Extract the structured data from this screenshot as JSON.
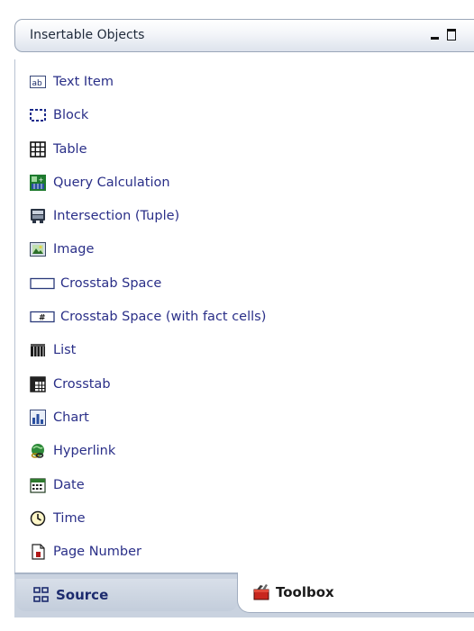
{
  "panel": {
    "title": "Insertable Objects"
  },
  "items": [
    {
      "label": "Text Item",
      "icon": "text-item-icon"
    },
    {
      "label": "Block",
      "icon": "block-icon"
    },
    {
      "label": "Table",
      "icon": "table-icon"
    },
    {
      "label": "Query Calculation",
      "icon": "query-calculation-icon"
    },
    {
      "label": "Intersection (Tuple)",
      "icon": "intersection-icon"
    },
    {
      "label": "Image",
      "icon": "image-icon"
    },
    {
      "label": "Crosstab Space",
      "icon": "crosstab-space-icon"
    },
    {
      "label": "Crosstab Space (with fact cells)",
      "icon": "crosstab-space-fact-icon"
    },
    {
      "label": "List",
      "icon": "list-icon"
    },
    {
      "label": "Crosstab",
      "icon": "crosstab-icon"
    },
    {
      "label": "Chart",
      "icon": "chart-icon"
    },
    {
      "label": "Hyperlink",
      "icon": "hyperlink-icon"
    },
    {
      "label": "Date",
      "icon": "date-icon"
    },
    {
      "label": "Time",
      "icon": "time-icon"
    },
    {
      "label": "Page Number",
      "icon": "page-number-icon"
    }
  ],
  "tabs": {
    "source": {
      "label": "Source",
      "icon": "source-icon"
    },
    "toolbox": {
      "label": "Toolbox",
      "icon": "toolbox-icon"
    }
  },
  "colors": {
    "item_text": "#2a2f88",
    "tab_strip": "#c9d2df"
  }
}
